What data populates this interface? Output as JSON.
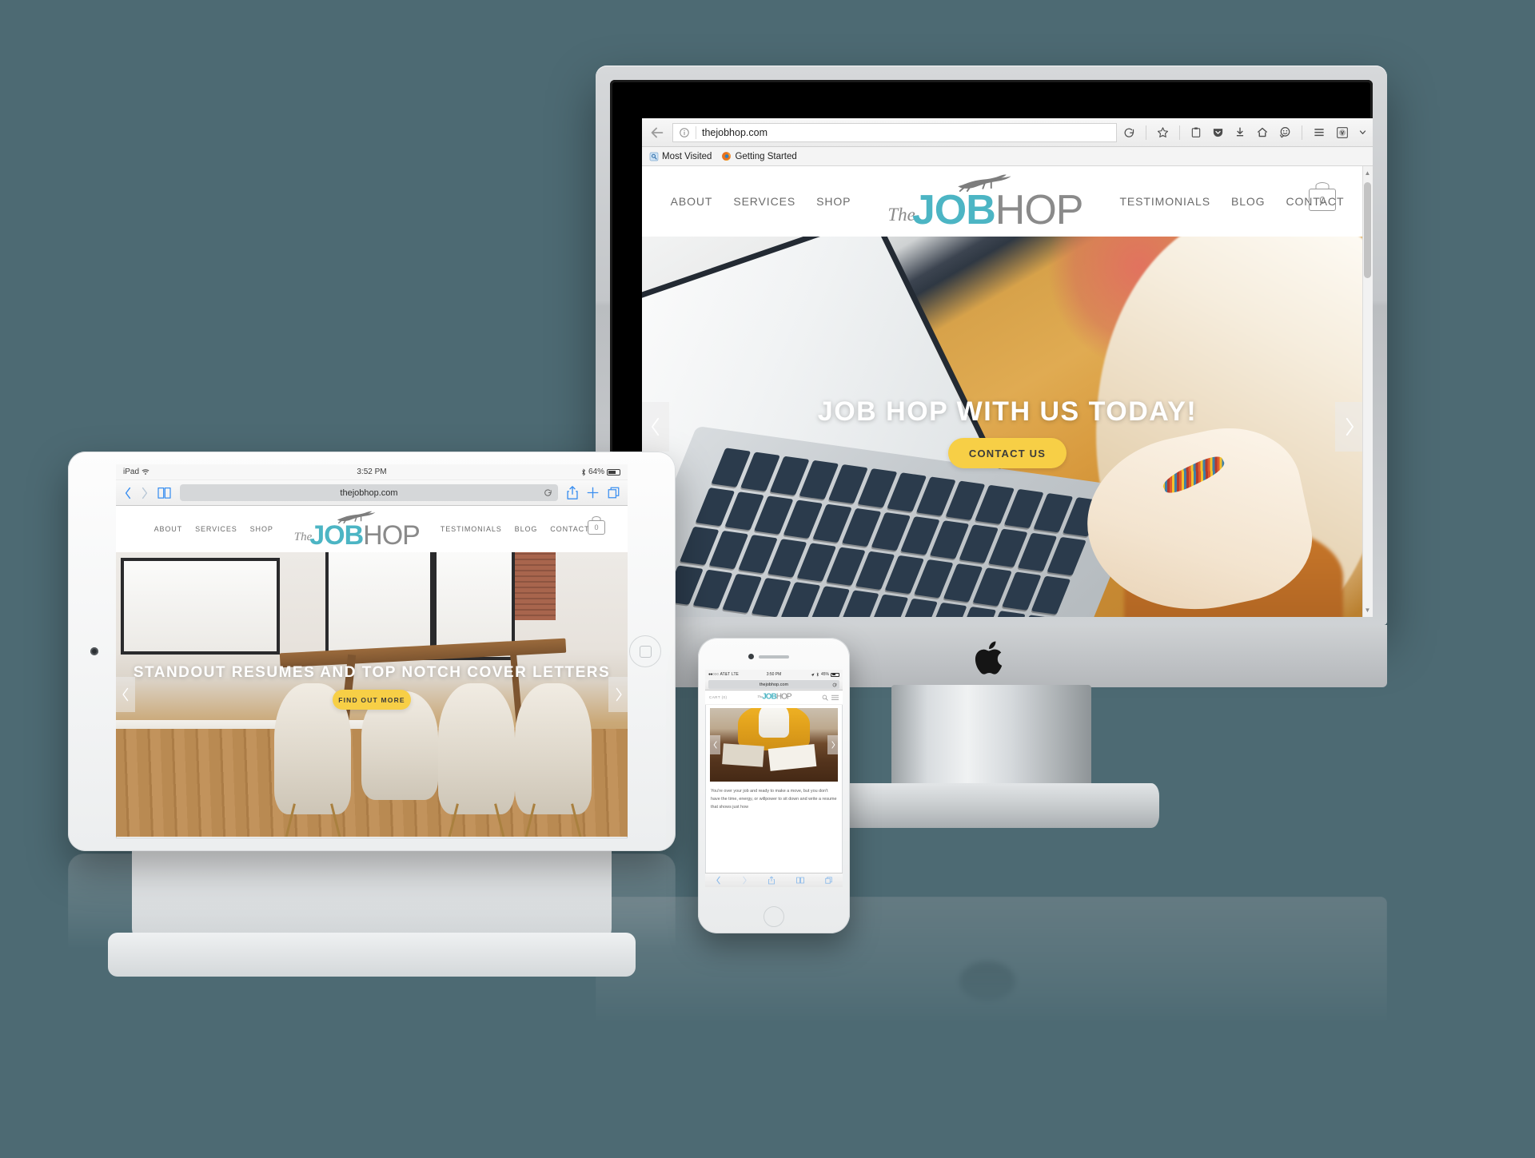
{
  "background_color": "#4d6a73",
  "brand": {
    "name": "The Job Hop",
    "logo_the": "The",
    "logo_job": "JOB",
    "logo_hop": "HOP",
    "teal": "#4cb5c4",
    "gray": "#8a8a8a",
    "accent_yellow": "#f7cf46"
  },
  "desktop": {
    "device": "iMac",
    "browser": {
      "name": "Firefox",
      "url": "thejobhop.com",
      "back_icon": "back-arrow-icon",
      "info_icon": "page-info-icon",
      "toolbar_icons": [
        "reload-icon",
        "bookmark-star-icon",
        "reader-clipboard-icon",
        "pocket-icon",
        "downloads-icon",
        "home-icon",
        "smiley-icon",
        "hamburger-menu-icon",
        "profile-avatar-icon",
        "chevron-down-icon"
      ],
      "bookmarks": [
        {
          "label": "Most Visited",
          "icon": "most-visited-icon"
        },
        {
          "label": "Getting Started",
          "icon": "firefox-icon"
        }
      ]
    },
    "nav_left": [
      "ABOUT",
      "SERVICES",
      "SHOP"
    ],
    "nav_right": [
      "TESTIMONIALS",
      "BLOG",
      "CONTACT"
    ],
    "cart_count": "0",
    "hero": {
      "title": "JOB HOP WITH US TODAY!",
      "button": "CONTACT US",
      "prev_icon": "chevron-left-icon",
      "next_icon": "chevron-right-icon",
      "image_alt": "blonde woman typing on a laptop at a wooden desk"
    }
  },
  "tablet": {
    "device": "iPad",
    "status": {
      "carrier": "iPad",
      "wifi_icon": "wifi-icon",
      "time": "3:52 PM",
      "bluetooth_icon": "bluetooth-icon",
      "battery": "64%"
    },
    "browser": {
      "name": "Safari",
      "url": "thejobhop.com",
      "back_icon": "chevron-left-icon",
      "forward_icon": "chevron-right-icon",
      "bookmarks_icon": "book-icon",
      "reload_icon": "reload-icon",
      "share_icon": "share-icon",
      "new_tab_icon": "plus-icon",
      "tabs_icon": "tabs-icon"
    },
    "nav_left": [
      "ABOUT",
      "SERVICES",
      "SHOP"
    ],
    "nav_right": [
      "TESTIMONIALS",
      "BLOG",
      "CONTACT"
    ],
    "cart_count": "0",
    "hero": {
      "title": "STANDOUT RESUMES AND TOP NOTCH COVER LETTERS",
      "button": "FIND OUT MORE",
      "prev_icon": "chevron-left-icon",
      "next_icon": "chevron-right-icon",
      "image_alt": "modern dining room with white chairs and wooden table by windows"
    }
  },
  "phone": {
    "device": "iPhone",
    "status": {
      "carrier": "AT&T",
      "network": "LTE",
      "time": "3:50 PM",
      "location_icon": "location-arrow-icon",
      "bluetooth_icon": "bluetooth-icon",
      "battery": "45%"
    },
    "browser": {
      "name": "Safari",
      "url": "thejobhop.com",
      "reload_icon": "reload-icon",
      "back_icon": "chevron-left-icon",
      "forward_icon": "chevron-right-icon",
      "share_icon": "share-icon",
      "bookmarks_icon": "book-icon",
      "tabs_icon": "tabs-icon"
    },
    "nav": {
      "cart_label": "CART (0)",
      "search_icon": "search-icon",
      "menu_icon": "hamburger-menu-icon"
    },
    "hero": {
      "prev_icon": "chevron-left-icon",
      "next_icon": "chevron-right-icon",
      "image_alt": "person in a mustard jacket writing on paper at a wooden desk"
    },
    "body_text": "You're over your job and ready to make a move, but you don't have the time, energy, or willpower to sit down and write a resume that shows just how"
  }
}
